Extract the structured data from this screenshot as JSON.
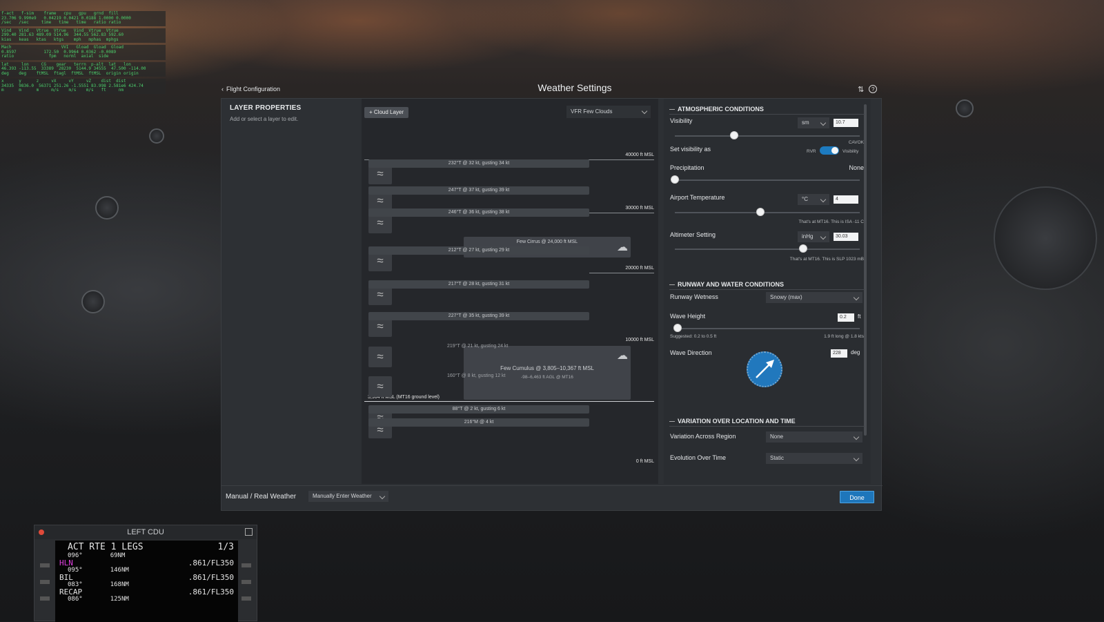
{
  "hud": {
    "rows": [
      "f-act   f-sim    frame   cpu   gpu   grnd  fill\n23.706 9.990e9   0.04219 0.0421 0.0188 1.0000 0.0000\n/sec   /sec     time   time   time   ratio ratio",
      "Vind   Vind   Vtrue  Vtrue   Vind  Vtrue  Vtrue\n299.40 281.63 489.09 514.96  344.55 562.83 592.60\nkias   keas   ktas   ktgs    mph   mphas  mphgs",
      "Mach                    VVI   Gload  Gload  Gload\n0.8597           172.50  0.9964 0.0362 -0.0089\nratio              fpm   norml  axial  side",
      "lat     lon     CG    gear   terrn  p-alt  lat   lon\n46.393 -113.55  33389  28230  5144.9 34555  47.500 -114.00\ndeg    deg    ftMSL  ftagl  ftMSL  ftMSL  origin origin",
      "x      y      z     vX     vY     vZ    dist  dist\n34335  9836.0  56371 251.26 -1.5551 83.998 2.581e6 424.74\nm      m      m     m/s    m/s    m/s   ft     nm"
    ]
  },
  "cdu": {
    "title": "LEFT CDU",
    "page": "ACT RTE 1 LEGS",
    "page_num": "1/3",
    "rows": [
      {
        "course": "096°",
        "dist": "69NM",
        "fix": "HLN",
        "speed": ".861/FL350"
      },
      {
        "course": "095°",
        "dist": "146NM",
        "fix": "BIL",
        "speed": ".861/FL350"
      },
      {
        "course": "083°",
        "dist": "168NM",
        "fix": "RECAP",
        "speed": ".861/FL350"
      },
      {
        "course": "086°",
        "dist": "125NM",
        "fix": "",
        "speed": ""
      }
    ]
  },
  "header": {
    "breadcrumb": "Flight Configuration",
    "title": "Weather Settings",
    "icons": [
      "sliders-icon",
      "help-icon"
    ]
  },
  "layer_properties": {
    "title": "LAYER PROPERTIES",
    "hint": "Add or select a layer to edit."
  },
  "layers": {
    "add_button": "+ Cloud Layer",
    "preset": "VFR Few Clouds",
    "altitudes": [
      "40000 ft MSL",
      "30000 ft MSL",
      "20000 ft MSL",
      "10000 ft MSL",
      "0 ft MSL"
    ],
    "ground_label": "3,904 ft MSL (MT16 ground level)",
    "winds": [
      "232°T @ 32 kt, gusting 34 kt",
      "247°T @ 37 kt, gusting 39 kt",
      "246°T @ 36 kt, gusting 38 kt",
      "212°T @ 27 kt, gusting 29 kt",
      "217°T @ 28 kt, gusting 31 kt",
      "227°T @ 35 kt, gusting 39 kt",
      "219°T @ 21 kt, gusting 24 kt",
      "160°T @ 8 kt, gusting 12 kt",
      "88°T @ 2 kt, gusting 6 kt",
      "216°M @ 4 kt"
    ],
    "cirrus": "Few Cirrus @ 24,000 ft MSL",
    "cumulus": "Few Cumulus @ 3,805–10,367 ft MSL",
    "cumulus_sub": "-98–6,463 ft AGL @ MT16"
  },
  "atmo": {
    "title": "ATMOSPHERIC CONDITIONS",
    "visibility_label": "Visibility",
    "visibility_unit": "sm",
    "visibility_value": "10.7",
    "set_vis_label": "Set visibility as",
    "cavok": "CAVOK",
    "rvr": "RVR",
    "vis_opt": "Visibility",
    "precip_label": "Precipitation",
    "precip_value": "None",
    "temp_label": "Airport Temperature",
    "temp_unit": "°C",
    "temp_value": "4",
    "temp_note": "That's at MT16. This is ISA -11 C",
    "alt_label": "Altimeter Setting",
    "alt_unit": "inHg",
    "alt_value": "30.03",
    "alt_note": "That's at MT16. This is SLP 1023 mB"
  },
  "runway": {
    "title": "RUNWAY AND WATER CONDITIONS",
    "wetness_label": "Runway Wetness",
    "wetness_value": "Snowy (max)",
    "wave_label": "Wave Height",
    "wave_value": "0.2",
    "wave_unit": "ft",
    "wave_suggest": "Suggested: 0.2 to 0.5 ft",
    "wave_note": "1.9 ft long @ 1.8 kts",
    "dir_label": "Wave Direction",
    "dir_value": "228",
    "dir_unit": "deg"
  },
  "variation": {
    "title": "VARIATION OVER LOCATION AND TIME",
    "region_label": "Variation Across Region",
    "region_value": "None",
    "evolution_label": "Evolution Over Time",
    "evolution_value": "Static"
  },
  "footer": {
    "label": "Manual / Real Weather",
    "mode": "Manually Enter Weather",
    "done": "Done"
  },
  "colors": {
    "accent": "#1e76bb",
    "hud": "#4cd16c",
    "cdu_magenta": "#e040e0"
  }
}
